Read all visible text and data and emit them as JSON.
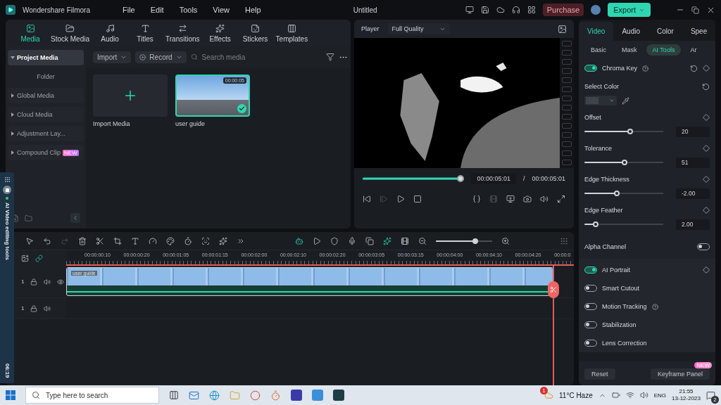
{
  "app": {
    "name": "Wondershare Filmora",
    "menu": [
      "File",
      "Edit",
      "Tools",
      "View",
      "Help"
    ],
    "title": "Untitled",
    "purchase": "Purchase",
    "export": "Export"
  },
  "media_tabs": [
    {
      "label": "Media",
      "selected": true
    },
    {
      "label": "Stock Media",
      "selected": false
    },
    {
      "label": "Audio",
      "selected": false
    },
    {
      "label": "Titles",
      "selected": false
    },
    {
      "label": "Transitions",
      "selected": false
    },
    {
      "label": "Effects",
      "selected": false
    },
    {
      "label": "Stickers",
      "selected": false
    },
    {
      "label": "Templates",
      "selected": false
    }
  ],
  "media_sidebar": [
    {
      "label": "Project Media",
      "kind": "group",
      "selected": true
    },
    {
      "label": "Folder",
      "kind": "folder",
      "selected": false
    },
    {
      "label": "Global Media",
      "kind": "group",
      "selected": false
    },
    {
      "label": "Cloud Media",
      "kind": "group",
      "selected": false
    },
    {
      "label": "Adjustment Lay...",
      "kind": "group",
      "selected": false
    },
    {
      "label": "Compound Clip",
      "kind": "group",
      "selected": false,
      "badge": "NEW"
    }
  ],
  "media_toolbar": {
    "import": "Import",
    "record": "Record",
    "search_placeholder": "Search media"
  },
  "media_items": [
    {
      "kind": "import",
      "label": "Import Media"
    },
    {
      "kind": "clip",
      "label": "user guide",
      "duration": "00:00:05",
      "selected": true
    }
  ],
  "player": {
    "label": "Player",
    "quality": "Full Quality",
    "level": 1,
    "current_time": "00:00:05:01",
    "separator": "/",
    "total_time": "00:00:05:01"
  },
  "inspector": {
    "tabs": [
      {
        "label": "Video",
        "selected": true
      },
      {
        "label": "Audio",
        "selected": false
      },
      {
        "label": "Color",
        "selected": false
      },
      {
        "label": "Spee",
        "selected": false
      }
    ],
    "subtabs": [
      {
        "label": "Basic",
        "selected": false
      },
      {
        "label": "Mask",
        "selected": false
      },
      {
        "label": "AI Tools",
        "selected": true
      },
      {
        "label": "Ar",
        "selected": false
      }
    ],
    "chroma_key": {
      "label": "Chroma Key",
      "on": true
    },
    "select_color": "Select Color",
    "sliders": [
      {
        "label": "Offset",
        "level": 0.59,
        "value": "20"
      },
      {
        "label": "Tolerance",
        "level": 0.51,
        "value": "51"
      },
      {
        "label": "Edge Thickness",
        "level": 0.4,
        "value": "-2.00"
      },
      {
        "label": "Edge Feather",
        "level": 0.12,
        "value": "2.00"
      }
    ],
    "alpha_channel": {
      "label": "Alpha Channel",
      "on": false
    },
    "features": [
      {
        "label": "AI Portrait",
        "on": true,
        "help": false,
        "keyframe": true
      },
      {
        "label": "Smart Cutout",
        "on": false,
        "help": false,
        "keyframe": false
      },
      {
        "label": "Motion Tracking",
        "on": false,
        "help": true,
        "keyframe": false
      },
      {
        "label": "Stabilization",
        "on": false,
        "help": false,
        "keyframe": false
      },
      {
        "label": "Lens Correction",
        "on": false,
        "help": false,
        "keyframe": false
      }
    ],
    "reset": "Reset",
    "keyframe_panel": {
      "label": "Keyframe Panel",
      "badge": "NEW"
    }
  },
  "timeline": {
    "ruler": [
      "00:00:00:10",
      "00:00:00:20",
      "00:00:01:05",
      "00:00:01:15",
      "00:00:02:00",
      "00:00:02:10",
      "00:00:02:20",
      "00:00:03:05",
      "00:00:03:15",
      "00:00:04:00",
      "00:00:04:10",
      "00:00:04:20",
      "00:00:0"
    ],
    "zoom": {
      "level": 0.72
    },
    "clip": {
      "label": "user guide"
    },
    "tracks": [
      {
        "kind": "video",
        "number": "1"
      },
      {
        "kind": "audio",
        "number": "1"
      }
    ]
  },
  "side_panel": {
    "label": "AI Video editing tools",
    "time": "06:19"
  },
  "taskbar": {
    "search_placeholder": "Type here to search",
    "weather": "11°C Haze",
    "weather_badge": "1",
    "language": "ENG",
    "time": "21:55",
    "date": "13-12-2023",
    "notifications": "2"
  }
}
